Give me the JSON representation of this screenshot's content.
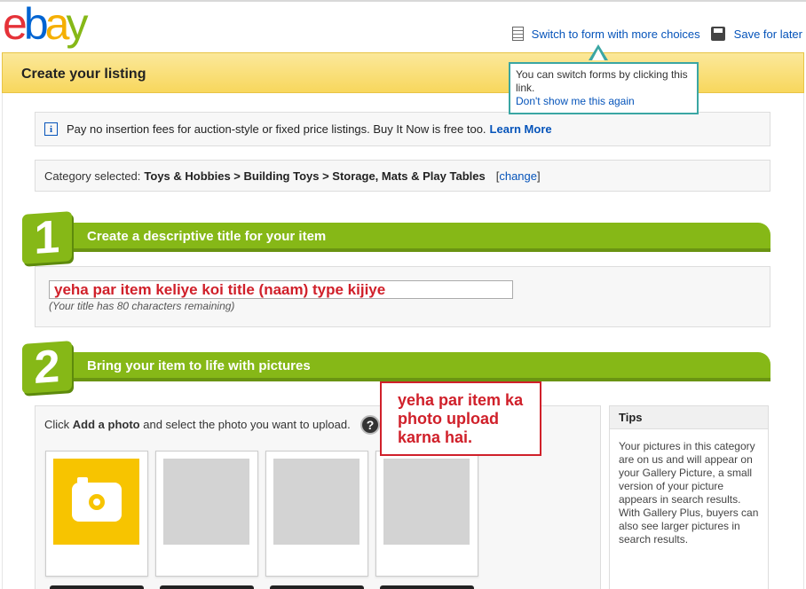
{
  "brand": {
    "logo_letters": [
      "e",
      "b",
      "a",
      "y"
    ]
  },
  "top_links": {
    "switch_form": "Switch to form with more choices",
    "save_later": "Save for later"
  },
  "header": {
    "title": "Create your listing"
  },
  "tooltip": {
    "text": "You can switch forms by clicking this link.",
    "dismiss": "Don't show me this again"
  },
  "info": {
    "icon": "i",
    "text": "Pay no insertion fees for auction-style or fixed price listings. Buy It Now is free too.",
    "link": "Learn More"
  },
  "category": {
    "label": "Category selected:",
    "path": "Toys & Hobbies > Building Toys > Storage, Mats & Play Tables",
    "change_open": "[",
    "change_link": "change",
    "change_close": "]"
  },
  "step1": {
    "number": "1",
    "title": "Create a descriptive title for your item",
    "input_value": "yeha par item keliye koi title (naam) type kijiye",
    "hint": "(Your title has 80 characters remaining)"
  },
  "step2": {
    "number": "2",
    "title": "Bring your item to life with pictures",
    "instr_prefix": "Click",
    "instr_bold": "Add a photo",
    "instr_suffix": "and select the photo you want to upload.",
    "help": "?"
  },
  "annotation": {
    "text": "yeha par item ka photo upload karna hai."
  },
  "tips": {
    "heading": "Tips",
    "body": "Your pictures in this category are on us and will appear on your Gallery Picture, a small version of your picture appears in search results. With Gallery Plus, buyers can also see larger pictures in search results."
  },
  "colors": {
    "accent_green": "#86b817",
    "header_yellow": "#f8d75d",
    "link_blue": "#0654ba",
    "annotation_red": "#d0202a",
    "tooltip_teal": "#3aa6a3"
  }
}
